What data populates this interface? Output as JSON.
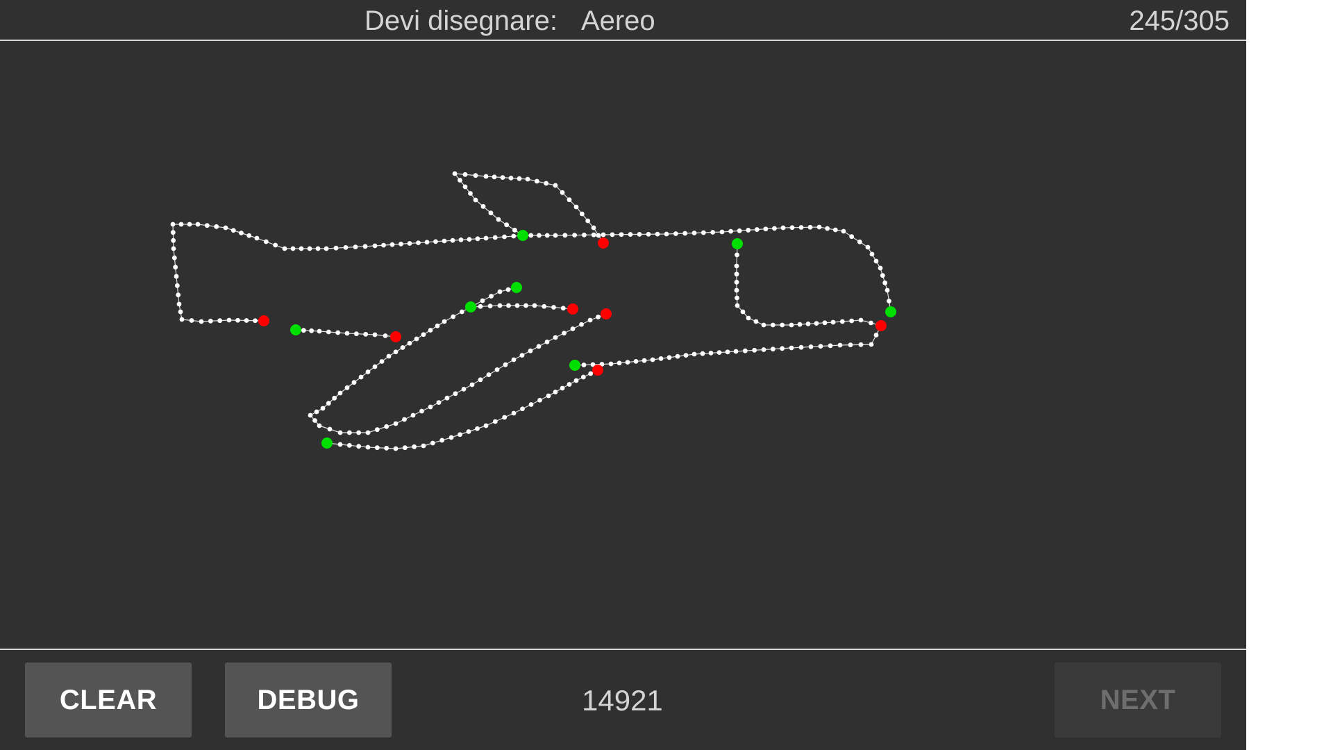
{
  "header": {
    "prompt_label": "Devi disegnare:",
    "prompt_word": "Aereo",
    "progress": "245/305"
  },
  "footer": {
    "clear_label": "CLEAR",
    "debug_label": "DEBUG",
    "score": "14921",
    "next_label": "NEXT",
    "next_enabled": false
  },
  "colors": {
    "background": "#303030",
    "stroke": "#ffffff",
    "stroke_start": "#00e000",
    "stroke_end": "#ff0000"
  }
}
